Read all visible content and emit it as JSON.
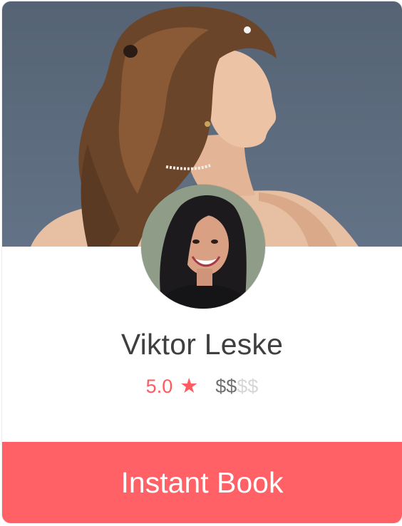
{
  "profile": {
    "name": "Viktor Leske",
    "rating": "5.0",
    "rating_icon": "star-icon",
    "price_active": "$$",
    "price_inactive": "$$"
  },
  "action": {
    "book_label": "Instant Book"
  },
  "colors": {
    "accent": "#ff5a5f",
    "button": "#ff6166",
    "name_text": "#3f3f3f",
    "price_active": "#707070",
    "price_inactive": "#d6d6d6"
  }
}
